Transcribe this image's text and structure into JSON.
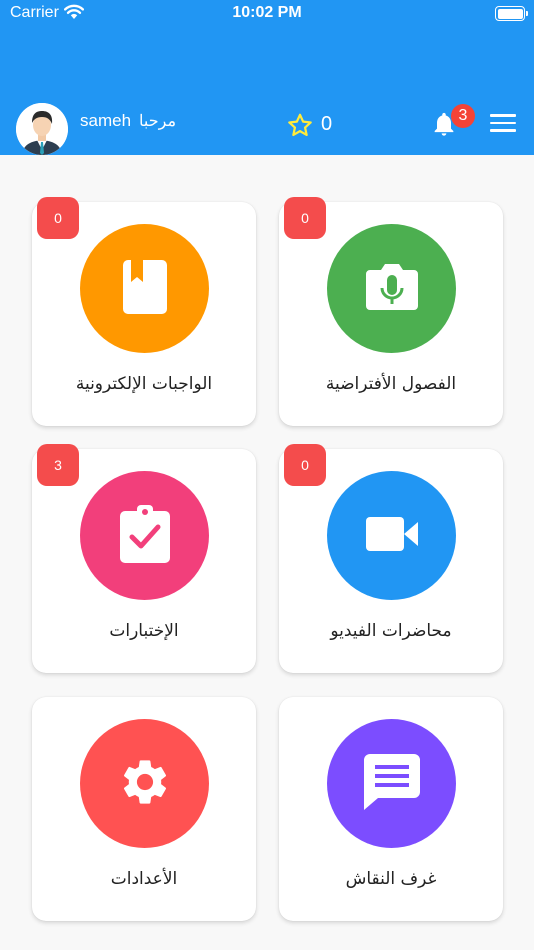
{
  "status_bar": {
    "carrier": "Carrier",
    "time": "10:02 PM"
  },
  "header": {
    "welcome": "مرحبا",
    "username": "sameh",
    "stars_count": "0",
    "notifications_count": "3",
    "background_color": "#2196F3"
  },
  "grid": {
    "items": [
      {
        "label": "الفصول الأفتراضية",
        "badge": "0",
        "color": "#4CAF50",
        "icon": "camera-mic-icon"
      },
      {
        "label": "الواجبات الإلكترونية",
        "badge": "0",
        "color": "#FF9800",
        "icon": "book-icon"
      },
      {
        "label": "محاضرات الفيديو",
        "badge": "0",
        "color": "#2196F3",
        "icon": "video-camera-icon"
      },
      {
        "label": "الإختبارات",
        "badge": "3",
        "color": "#F23F7B",
        "icon": "clipboard-check-icon"
      },
      {
        "label": "غرف النقاش",
        "color": "#7C4DFF",
        "icon": "chat-message-icon"
      },
      {
        "label": "الأعدادات",
        "color": "#FF5252",
        "icon": "gear-icon"
      }
    ]
  }
}
